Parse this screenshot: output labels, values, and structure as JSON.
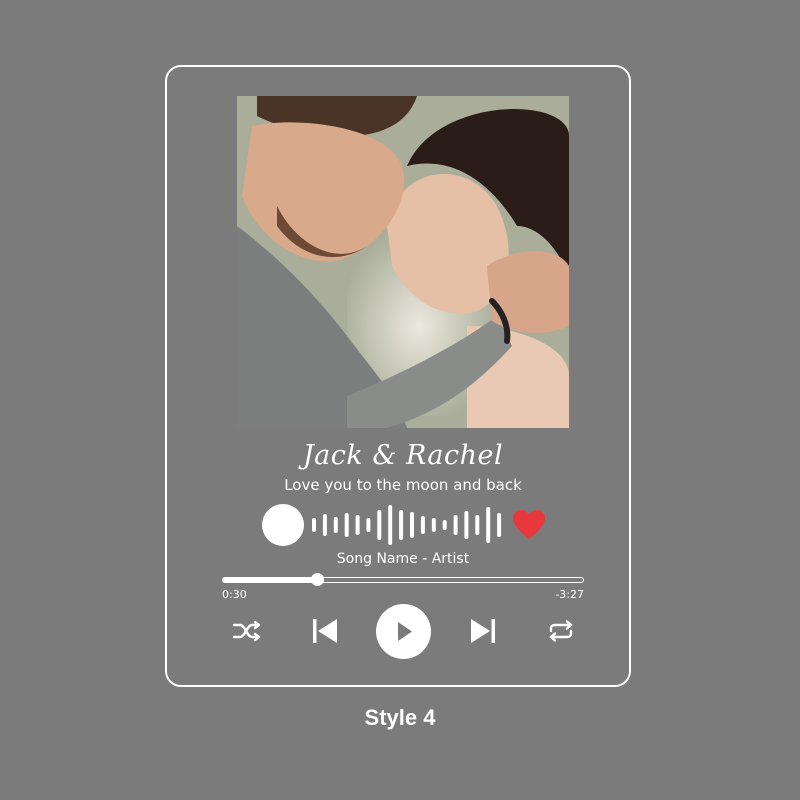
{
  "card": {
    "names": "Jack & Rachel",
    "tagline": "Love you to the moon and back",
    "song": "Song Name - Artist",
    "photo_icon": "couple-photo",
    "favorite_icon": "heart-icon",
    "accent_heart_color": "#e8383d"
  },
  "player": {
    "elapsed": "0:30",
    "remaining": "-3:27",
    "progress_fraction": 0.26,
    "controls": [
      "shuffle-icon",
      "previous-icon",
      "play-icon",
      "next-icon",
      "repeat-icon"
    ]
  },
  "caption": "Style 4"
}
